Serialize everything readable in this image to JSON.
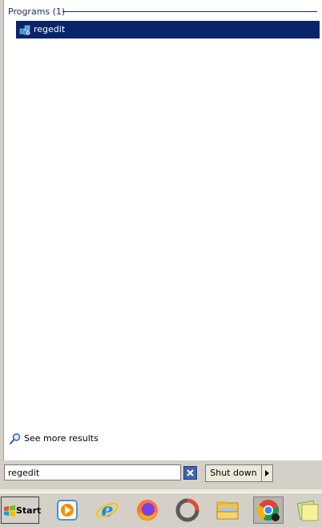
{
  "results": {
    "section_title": "Programs (1)",
    "items": [
      {
        "label": "regedit",
        "icon": "regedit-icon"
      }
    ],
    "see_more_label": "See more results"
  },
  "search": {
    "value": "regedit"
  },
  "shutdown": {
    "label": "Shut down"
  },
  "taskbar": {
    "start_label": "Start",
    "icons": [
      "windows-media-player-icon",
      "internet-explorer-icon",
      "firefox-icon",
      "app-ring-icon",
      "file-explorer-icon",
      "chrome-icon",
      "sticky-notes-icon"
    ]
  },
  "colors": {
    "selection": "#0a246a",
    "header_text": "#1b2d60",
    "chrome_bg": "#d4d0c8"
  }
}
